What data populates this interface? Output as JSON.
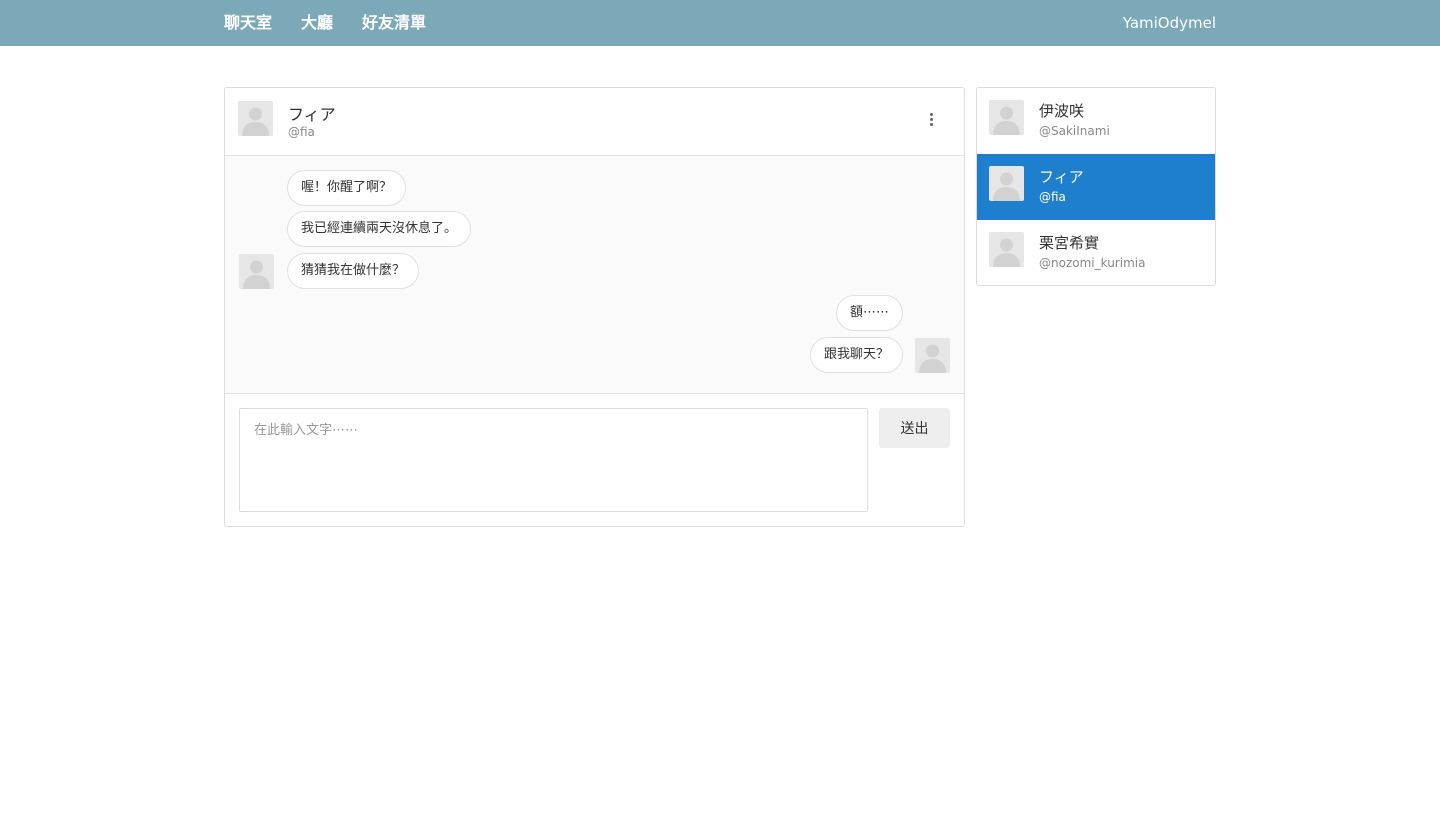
{
  "nav": {
    "links": [
      "聊天室",
      "大廳",
      "好友清單"
    ],
    "user": "YamiOdymel",
    "bar_color": "#7ba9b8"
  },
  "chat": {
    "contact_name": "フィア",
    "contact_handle": "@fia",
    "incoming": [
      "喔！你醒了啊？",
      "我已經連續兩天沒休息了。",
      "猜猜我在做什麼？"
    ],
    "outgoing": [
      "額⋯⋯",
      "跟我聊天？"
    ],
    "input_placeholder": "在此輸入文字⋯⋯",
    "send_label": "送出"
  },
  "friends": [
    {
      "name": "伊波咲",
      "handle": "@SakiInami",
      "active": false
    },
    {
      "name": "フィア",
      "handle": "@fia",
      "active": true
    },
    {
      "name": "栗宮希實",
      "handle": "@nozomi_kurimia",
      "active": false
    }
  ],
  "colors": {
    "active_friend": "#1e7fce"
  },
  "icons": {
    "avatar": "user-silhouette-icon",
    "menu": "more-vertical-icon"
  }
}
